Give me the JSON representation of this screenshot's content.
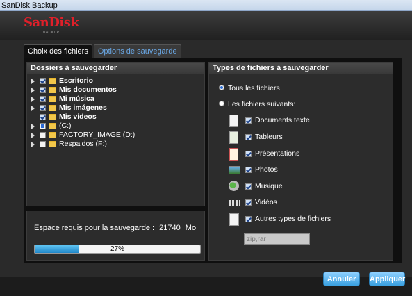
{
  "window": {
    "title": "SanDisk Backup"
  },
  "brand": {
    "name": "SanDisk",
    "tagline": "BACKUP",
    "color": "#e0202a"
  },
  "tabs": [
    {
      "label": "Choix des fichiers",
      "active": true
    },
    {
      "label": "Options de sauvegarde",
      "active": false
    }
  ],
  "folders_panel": {
    "title": "Dossiers à sauvegarder",
    "items": [
      {
        "label": "Escritorio",
        "expandable": true,
        "checked": true,
        "bold": true
      },
      {
        "label": "Mis documentos",
        "expandable": true,
        "checked": true,
        "bold": true
      },
      {
        "label": "Mi música",
        "expandable": true,
        "checked": true,
        "bold": true
      },
      {
        "label": "Mis imágenes",
        "expandable": true,
        "checked": true,
        "bold": true
      },
      {
        "label": "Mis videos",
        "expandable": false,
        "checked": true,
        "bold": true
      },
      {
        "label": "(C:)",
        "expandable": true,
        "checked": "partial",
        "bold": false
      },
      {
        "label": "FACTORY_IMAGE (D:)",
        "expandable": true,
        "checked": false,
        "bold": false
      },
      {
        "label": "Respaldos (F:)",
        "expandable": true,
        "checked": false,
        "bold": false
      }
    ]
  },
  "space": {
    "label": "Espace requis pour la sauvegarde :",
    "value": "21740",
    "unit": "Mo",
    "progress_percent": 27,
    "progress_label": "27%"
  },
  "types_panel": {
    "title": "Types de fichiers à sauvegarder",
    "radio_all": {
      "label": "Tous les fichiers",
      "selected": true
    },
    "radio_following": {
      "label": "Les fichiers suivants:",
      "selected": false
    },
    "types": [
      {
        "label": "Documents texte",
        "icon": "text-document-icon",
        "checked": true
      },
      {
        "label": "Tableurs",
        "icon": "spreadsheet-icon",
        "checked": true
      },
      {
        "label": "Présentations",
        "icon": "presentation-icon",
        "checked": true
      },
      {
        "label": "Photos",
        "icon": "photo-icon",
        "checked": true
      },
      {
        "label": "Musique",
        "icon": "music-icon",
        "checked": true
      },
      {
        "label": "Vidéos",
        "icon": "video-icon",
        "checked": true
      },
      {
        "label": "Autres types de fichiers",
        "icon": "other-files-icon",
        "checked": true
      }
    ],
    "other_extensions": "zip,rar"
  },
  "buttons": {
    "cancel": "Annuler",
    "apply": "Appliquer"
  }
}
